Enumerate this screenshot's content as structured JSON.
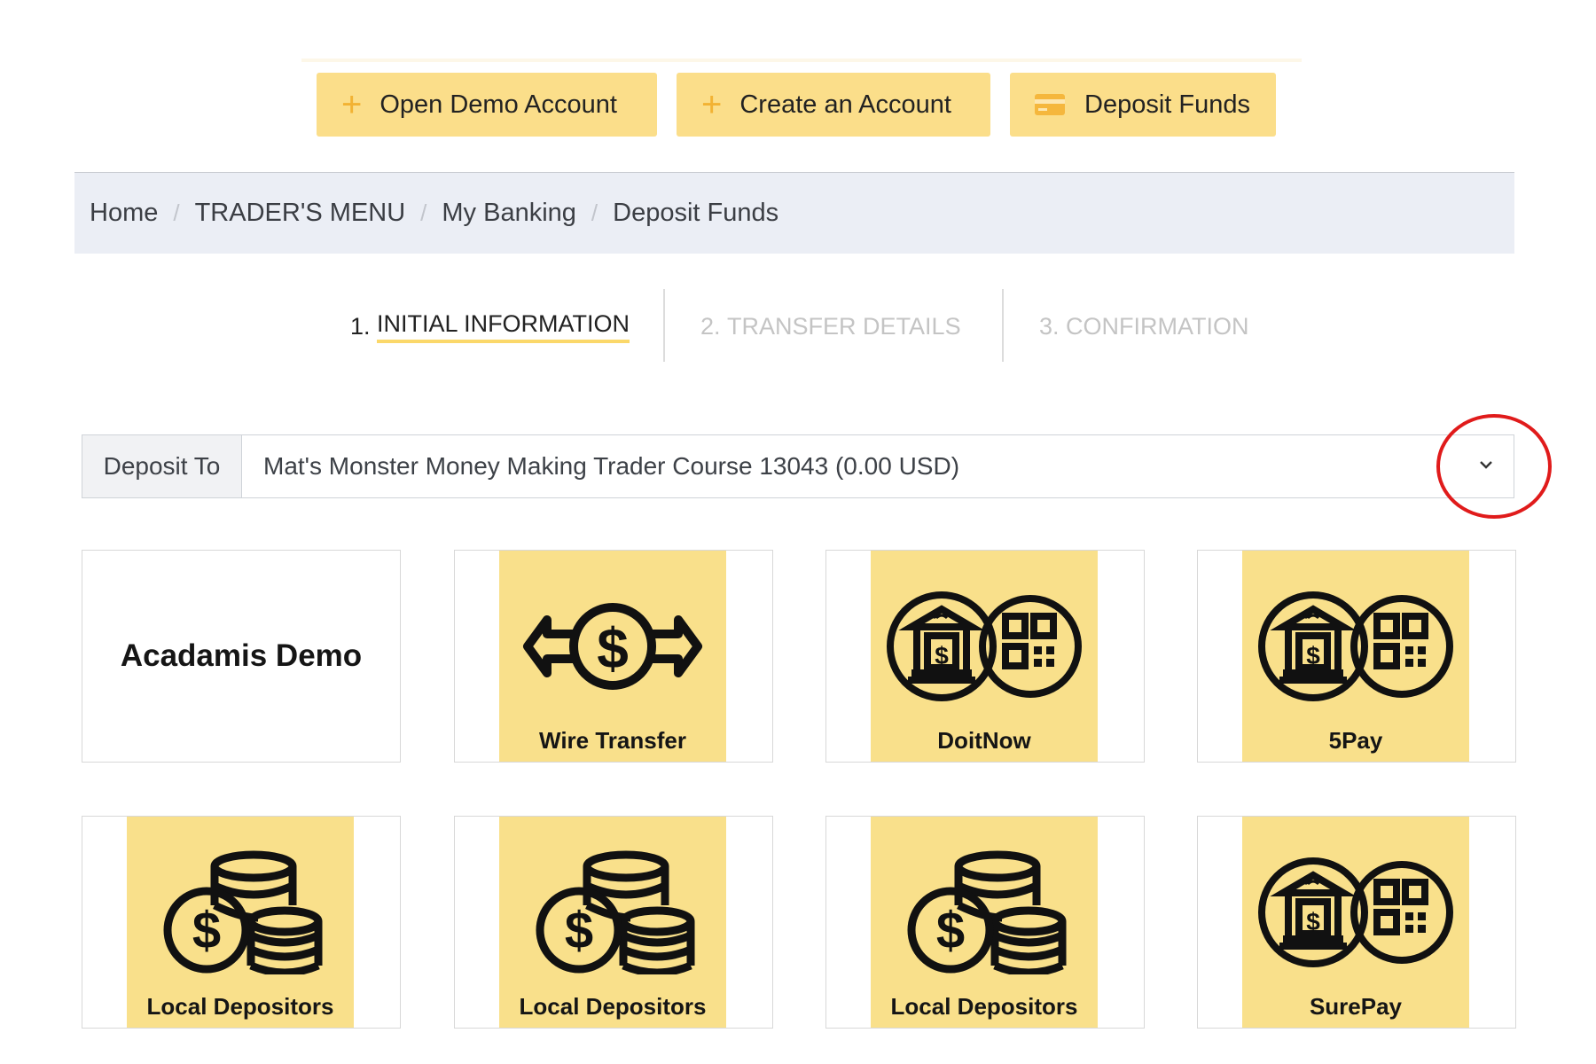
{
  "actions": {
    "open_demo": "Open Demo Account",
    "create_account": "Create an Account",
    "deposit_funds": "Deposit Funds"
  },
  "breadcrumb": [
    "Home",
    "TRADER'S MENU",
    "My Banking",
    "Deposit Funds"
  ],
  "steps": [
    {
      "num": "1.",
      "label": "INITIAL INFORMATION",
      "active": true
    },
    {
      "num": "2.",
      "label": "TRANSFER DETAILS",
      "active": false
    },
    {
      "num": "3.",
      "label": "CONFIRMATION",
      "active": false
    }
  ],
  "deposit": {
    "label": "Deposit To",
    "selected": "Mat's Monster Money Making Trader Course 13043 (0.00 USD)"
  },
  "methods": [
    {
      "title": "Acadamis Demo",
      "icon": "none"
    },
    {
      "title": "Wire Transfer",
      "icon": "wire-transfer-icon"
    },
    {
      "title": "DoitNow",
      "icon": "bank-qr-icon"
    },
    {
      "title": "5Pay",
      "icon": "bank-qr-icon"
    },
    {
      "title": "Local Depositors",
      "icon": "coins-icon"
    },
    {
      "title": "Local Depositors",
      "icon": "coins-icon"
    },
    {
      "title": "Local Depositors",
      "icon": "coins-icon"
    },
    {
      "title": "SurePay",
      "icon": "bank-qr-icon"
    }
  ],
  "colors": {
    "accent_yellow": "#fbde8a",
    "tile_yellow": "#f9e08b",
    "plus_orange": "#f2b233",
    "breadcrumb_bg": "#ebeef5",
    "highlight_red": "#e01b1b"
  }
}
